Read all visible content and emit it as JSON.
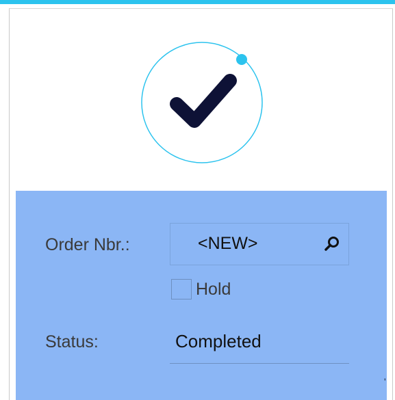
{
  "form": {
    "order_nbr_label": "Order Nbr.:",
    "order_nbr_value": "<NEW>",
    "hold_label": "Hold",
    "hold_checked": false,
    "status_label": "Status:",
    "status_value": "Completed"
  },
  "icons": {
    "success": "checkmark-circle-icon",
    "lookup": "search-icon"
  },
  "colors": {
    "accent": "#2cc3ee",
    "form_panel_bg": "#8bb6f5",
    "checkmark": "#0e1236"
  }
}
